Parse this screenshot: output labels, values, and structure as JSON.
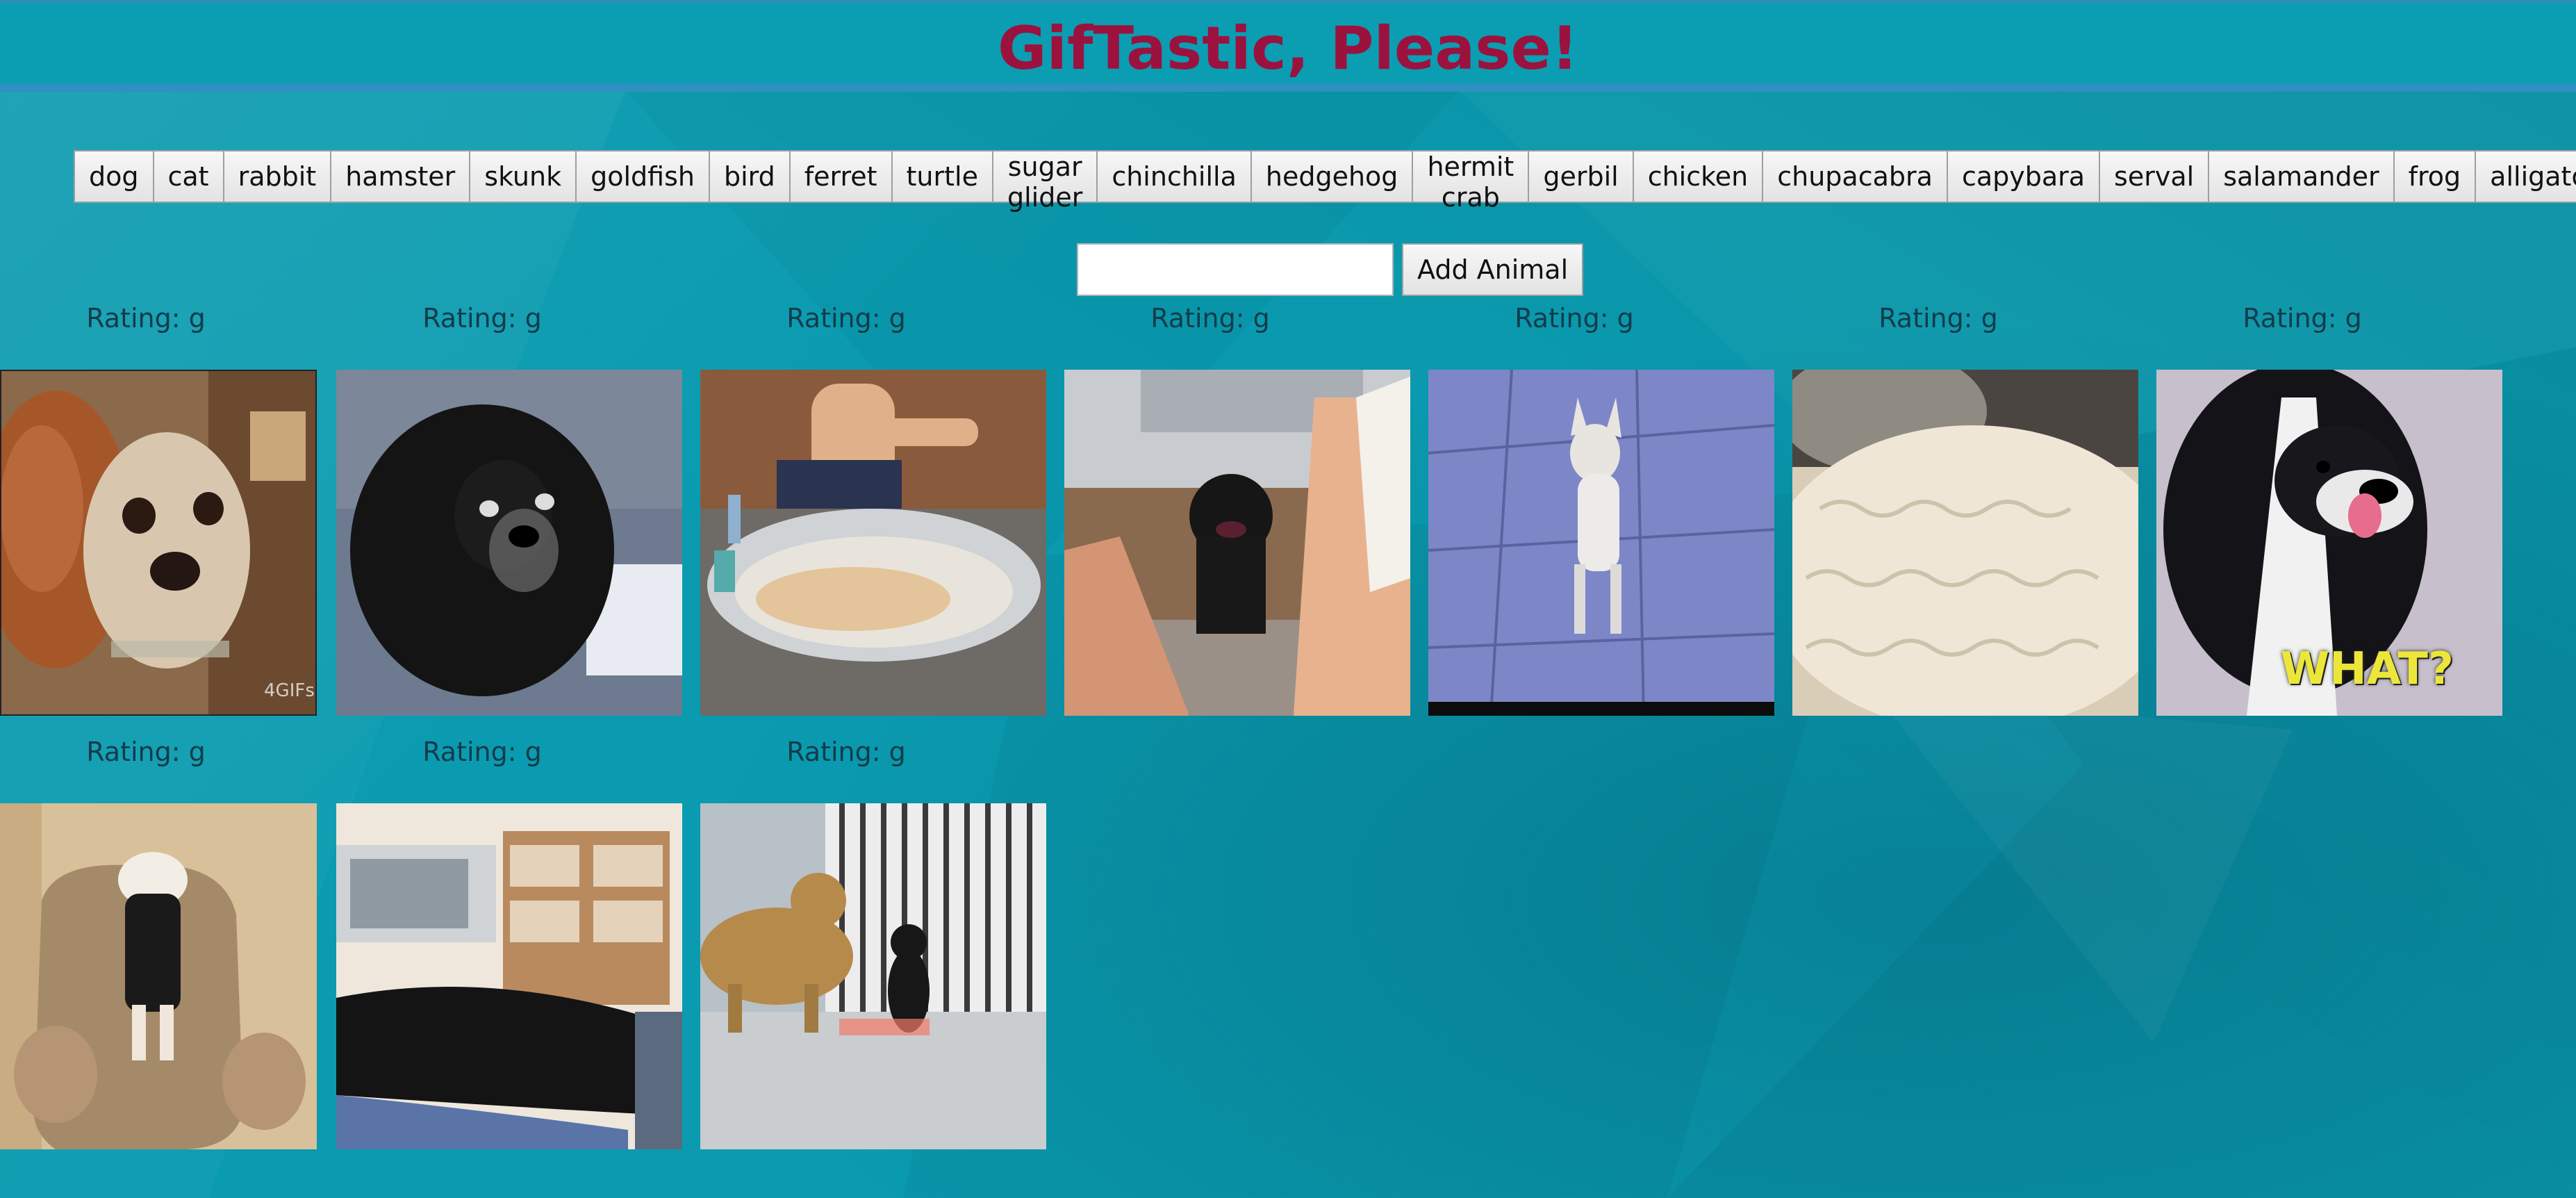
{
  "page": {
    "title": "GifTastic, Please!"
  },
  "animals": [
    "dog",
    "cat",
    "rabbit",
    "hamster",
    "skunk",
    "goldfish",
    "bird",
    "ferret",
    "turtle",
    "sugar glider",
    "chinchilla",
    "hedgehog",
    "hermit crab",
    "gerbil",
    "chicken",
    "chupacabra",
    "capybara",
    "serval",
    "salamander",
    "frog",
    "alligator"
  ],
  "form": {
    "input_value": "",
    "add_label": "Add Animal"
  },
  "gifs": [
    {
      "rating": "Rating: g",
      "subject": "two dogs close-up"
    },
    {
      "rating": "Rating: g",
      "subject": "black dog lying down"
    },
    {
      "rating": "Rating: g",
      "subject": "boy bathing dog"
    },
    {
      "rating": "Rating: g",
      "subject": "small black dog by person"
    },
    {
      "rating": "Rating: g",
      "subject": "white chihuahua standing"
    },
    {
      "rating": "Rating: g",
      "subject": "fluffy white rug"
    },
    {
      "rating": "Rating: g",
      "subject": "surprised dog",
      "caption": "WHAT?"
    },
    {
      "rating": "Rating: g",
      "subject": "dog dancing on armchair"
    },
    {
      "rating": "Rating: g",
      "subject": "black dog in living room"
    },
    {
      "rating": "Rating: g",
      "subject": "dog and cat near gate"
    }
  ],
  "colors": {
    "background": "#0a9bb0",
    "title": "#9b123f",
    "header_rule": "#2e91c1",
    "rating_text": "#123c4a"
  }
}
